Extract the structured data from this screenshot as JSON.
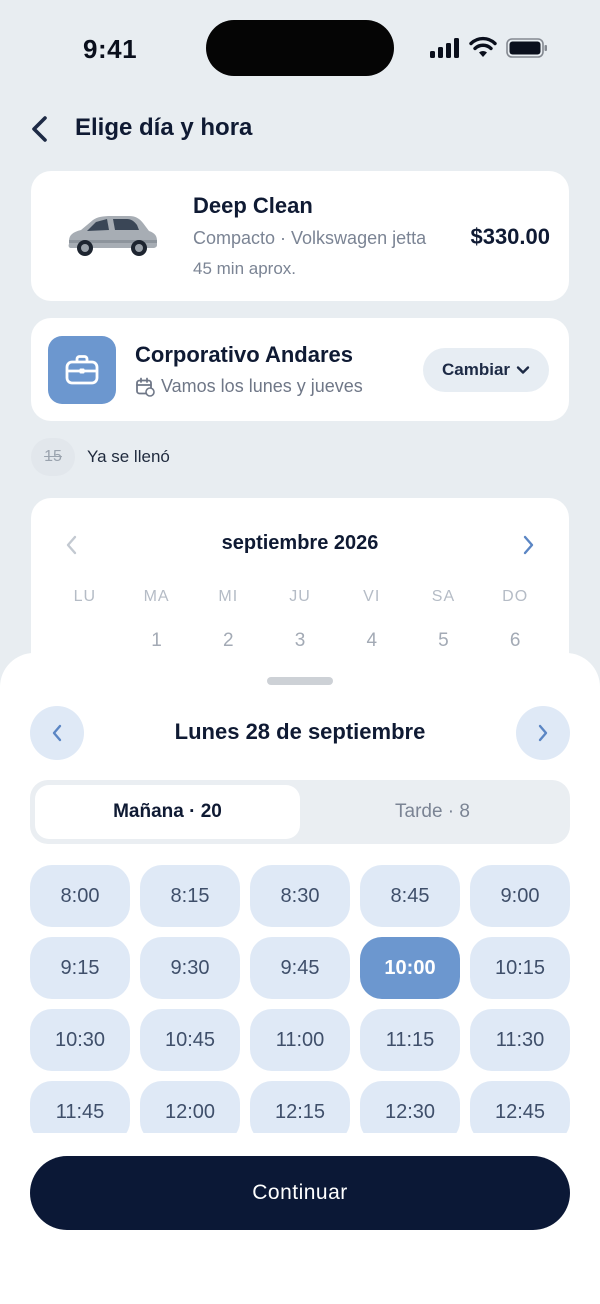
{
  "status_bar": {
    "time": "9:41"
  },
  "header": {
    "title": "Elige día y hora"
  },
  "service": {
    "name": "Deep Clean",
    "subtitle": "Compacto · Volkswagen jetta",
    "duration": "45 min aprox.",
    "price": "$330.00"
  },
  "location": {
    "name": "Corporativo Andares",
    "schedule": "Vamos los lunes y jueves",
    "change_label": "Cambiar"
  },
  "full_notice": {
    "day": "15",
    "text": "Ya se llenó"
  },
  "calendar": {
    "month": "septiembre 2026",
    "weekdays": [
      "LU",
      "MA",
      "MI",
      "JU",
      "VI",
      "SA",
      "DO"
    ],
    "first_row": [
      "",
      "1",
      "2",
      "3",
      "4",
      "5",
      "6"
    ]
  },
  "sheet": {
    "day_title": "Lunes 28 de septiembre",
    "segments": {
      "morning": "Mañana · 20",
      "afternoon": "Tarde · 8"
    },
    "selected_segment": "morning",
    "slots": [
      "8:00",
      "8:15",
      "8:30",
      "8:45",
      "9:00",
      "9:15",
      "9:30",
      "9:45",
      "10:00",
      "10:15",
      "10:30",
      "10:45",
      "11:00",
      "11:15",
      "11:30",
      "11:45",
      "12:00",
      "12:15",
      "12:30",
      "12:45"
    ],
    "selected_slot": "10:00",
    "continue_label": "Continuar"
  },
  "colors": {
    "accent": "#6c97cf",
    "primary_dark": "#0b1836",
    "slot_bg": "#dfe9f6",
    "page_bg": "#e8edf1"
  }
}
